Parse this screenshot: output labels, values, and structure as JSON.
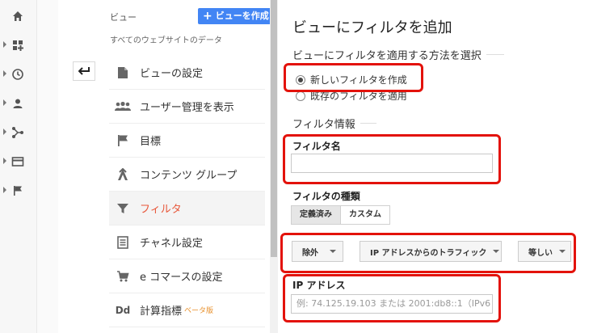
{
  "rail": {
    "items": [
      {
        "icon": "home-icon"
      },
      {
        "icon": "dashboard-icon"
      },
      {
        "icon": "clock-icon"
      },
      {
        "icon": "person-icon"
      },
      {
        "icon": "acquisition-icon"
      },
      {
        "icon": "card-icon"
      },
      {
        "icon": "flag-icon"
      }
    ]
  },
  "view": {
    "label": "ビュー",
    "create_button": "ビューを作成",
    "subtitle": "すべてのウェブサイトのデータ"
  },
  "menu": {
    "items": [
      {
        "label": "ビューの設定",
        "icon": "document-icon"
      },
      {
        "label": "ユーザー管理を表示",
        "icon": "people-icon"
      },
      {
        "label": "目標",
        "icon": "flag-icon"
      },
      {
        "label": "コンテンツ グループ",
        "icon": "content-group-icon"
      },
      {
        "label": "フィルタ",
        "icon": "filter-icon"
      },
      {
        "label": "チャネル設定",
        "icon": "channel-icon"
      },
      {
        "label": "e コマースの設定",
        "icon": "cart-icon"
      },
      {
        "label": "計算指標",
        "icon": "dd-icon",
        "badge": "ベータ版"
      }
    ]
  },
  "panel": {
    "title": "ビューにフィルタを追加",
    "method_heading": "ビューにフィルタを適用する方法を選択",
    "radio_new": "新しいフィルタを作成",
    "radio_existing": "既存のフィルタを適用",
    "info_heading": "フィルタ情報",
    "name_label": "フィルタ名",
    "name_value": "",
    "type_label": "フィルタの種類",
    "tab_predefined": "定義済み",
    "tab_custom": "カスタム",
    "dd_exclude": "除外",
    "dd_source": "IP アドレスからのトラフィック",
    "dd_equals": "等しい",
    "ip_label": "IP アドレス",
    "ip_placeholder": "例: 74.125.19.103 または 2001:db8::1（IPv6 の"
  },
  "colors": {
    "accent": "#4285f4",
    "active": "#e8573a",
    "highlight": "#e3120b"
  }
}
